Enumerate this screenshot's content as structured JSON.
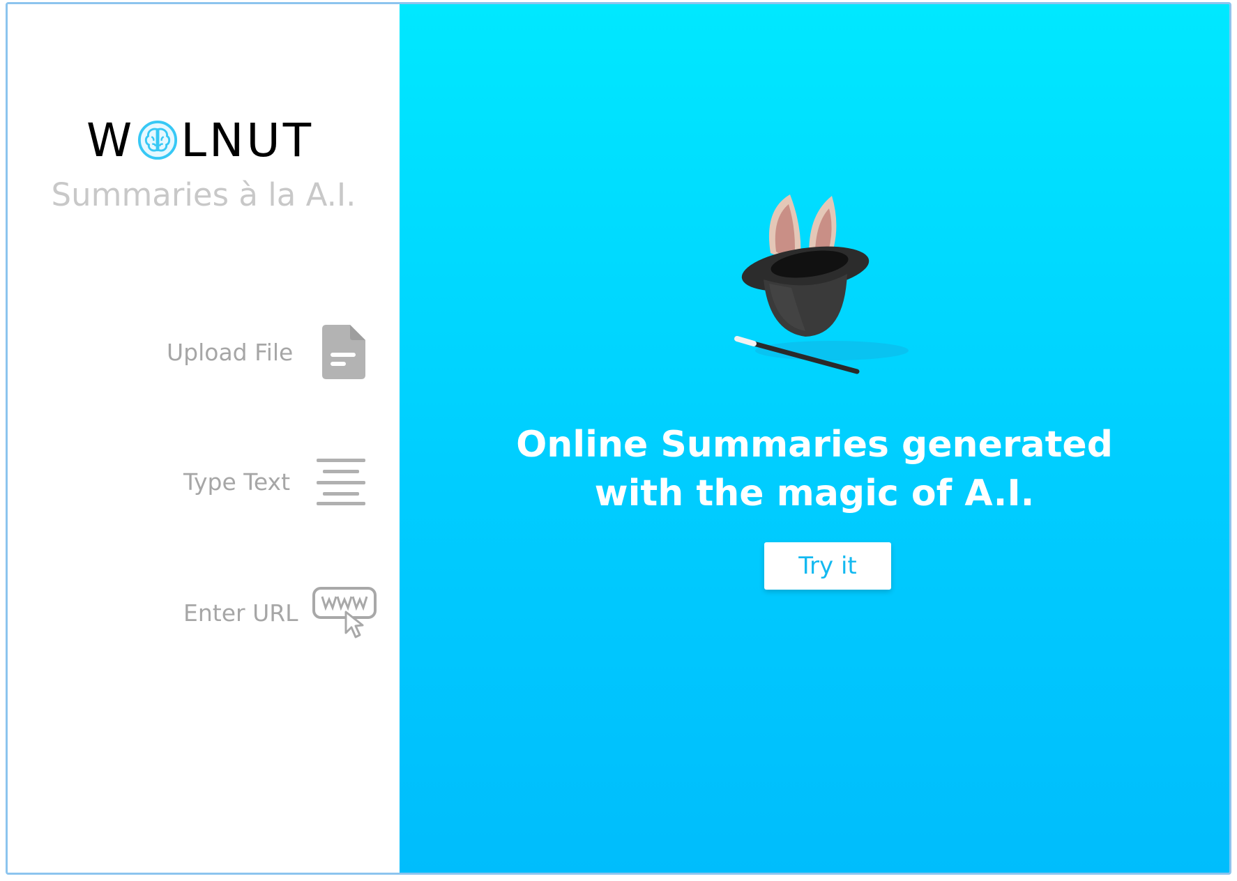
{
  "brand": {
    "logo_text_before": "W",
    "logo_text_after": "LNUT",
    "tagline": "Summaries à la A.I."
  },
  "sidebar": {
    "options": [
      {
        "label": "Upload File",
        "icon": "file-icon"
      },
      {
        "label": "Type Text",
        "icon": "align-center-icon"
      },
      {
        "label": "Enter URL",
        "icon": "www-cursor-icon"
      }
    ]
  },
  "hero": {
    "headline_line1": "Online Summaries generated",
    "headline_line2": "with the magic of A.I.",
    "cta_label": "Try it"
  },
  "colors": {
    "accent": "#00d4ff",
    "logo_brain": "#37c8f5",
    "muted_text": "#a6a6a6",
    "cta_text": "#14b9f0"
  }
}
